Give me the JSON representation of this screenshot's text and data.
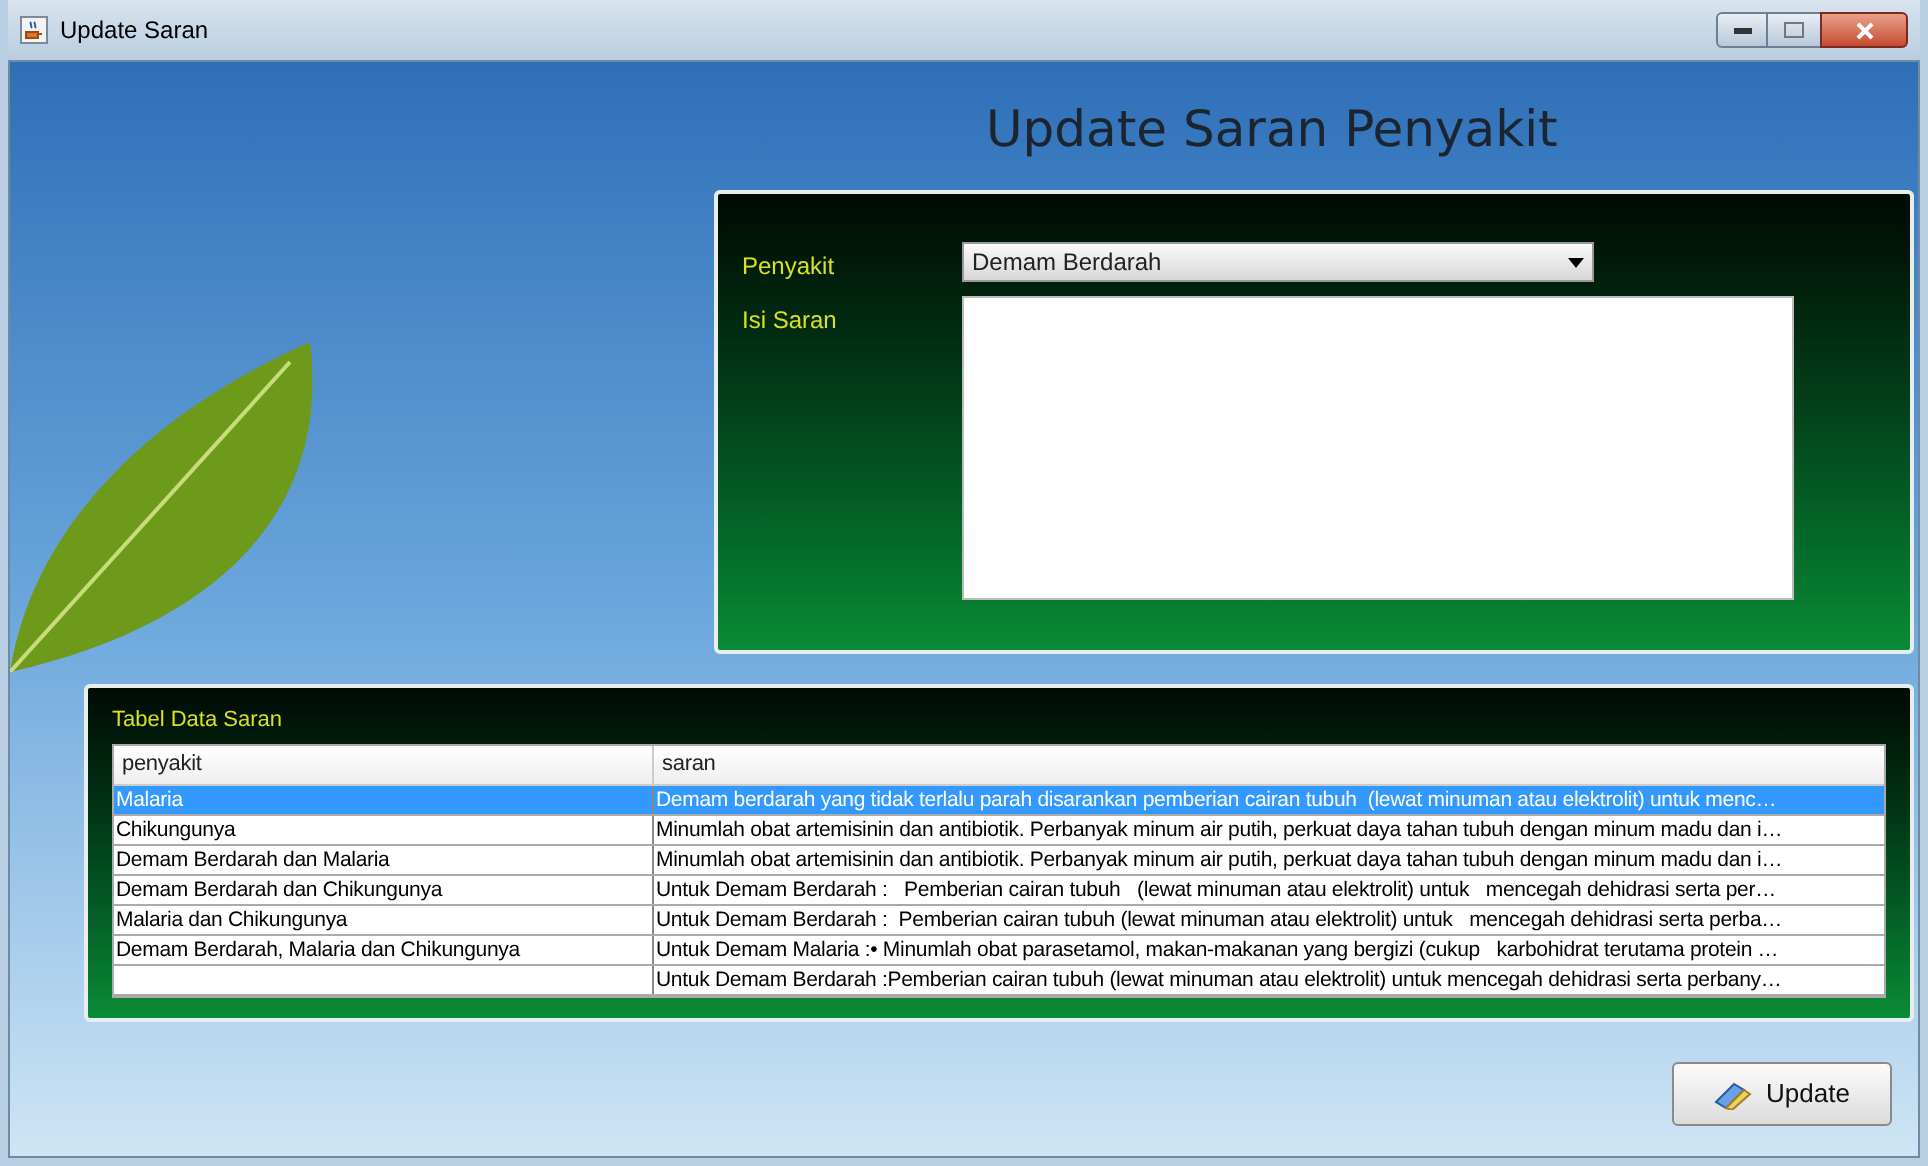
{
  "window": {
    "title": "Update Saran"
  },
  "heading": "Update Saran Penyakit",
  "form": {
    "fields": [
      {
        "kind": "combo",
        "label": "Penyakit",
        "value": "Demam Berdarah"
      },
      {
        "kind": "textarea",
        "label": "Isi Saran"
      }
    ]
  },
  "table": {
    "title": "Tabel Data Saran",
    "columns": [
      "penyakit",
      "saran"
    ],
    "rows": [
      {
        "selected": true,
        "cells": [
          "Malaria",
          "Demam berdarah yang tidak terlalu parah disarankan pemberian cairan tubuh  (lewat minuman atau elektrolit) untuk menc…"
        ]
      },
      {
        "selected": false,
        "cells": [
          "Chikungunya",
          "Minumlah obat artemisinin dan antibiotik. Perbanyak minum air putih, perkuat daya tahan tubuh dengan minum madu dan i…"
        ]
      },
      {
        "selected": false,
        "cells": [
          "Demam Berdarah dan Malaria",
          "Minumlah obat artemisinin dan antibiotik. Perbanyak minum air putih, perkuat daya tahan tubuh dengan minum madu dan i…"
        ]
      },
      {
        "selected": false,
        "cells": [
          "Demam Berdarah dan Chikungunya",
          "Untuk Demam Berdarah :   Pemberian cairan tubuh   (lewat minuman atau elektrolit) untuk   mencegah dehidrasi serta per…"
        ]
      },
      {
        "selected": false,
        "cells": [
          "Malaria dan Chikungunya",
          "Untuk Demam Berdarah :  Pemberian cairan tubuh (lewat minuman atau elektrolit) untuk   mencegah dehidrasi serta perba…"
        ]
      },
      {
        "selected": false,
        "cells": [
          "Demam Berdarah, Malaria dan Chikungunya",
          "Untuk Demam Malaria :• Minumlah obat parasetamol, makan-makanan yang bergizi (cukup   karbohidrat terutama protein …"
        ]
      },
      {
        "selected": false,
        "cells": [
          "",
          "Untuk Demam Berdarah :Pemberian cairan tubuh (lewat minuman atau elektrolit) untuk mencegah dehidrasi serta perbany…"
        ]
      }
    ]
  },
  "buttons": [
    {
      "label": "Update"
    }
  ]
}
